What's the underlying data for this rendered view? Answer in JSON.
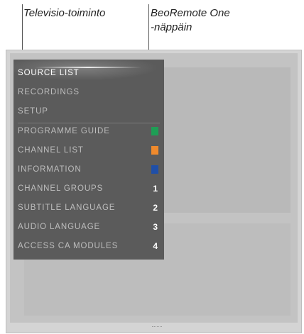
{
  "annotations": {
    "tv_function": "Televisio-toiminto",
    "remote_key_line1": "BeoRemote One",
    "remote_key_line2": "-näppäin"
  },
  "menu": {
    "selected": "SOURCE LIST",
    "items": [
      {
        "label": "SOURCE LIST",
        "key": ""
      },
      {
        "label": "RECORDINGS",
        "key": ""
      },
      {
        "label": "SETUP",
        "key": ""
      },
      {
        "label": "PROGRAMME GUIDE",
        "key": "",
        "color": "#1e9e55"
      },
      {
        "label": "CHANNEL LIST",
        "key": "",
        "color": "#f08a2c"
      },
      {
        "label": "INFORMATION",
        "key": "",
        "color": "#1f4fa8"
      },
      {
        "label": "CHANNEL GROUPS",
        "key": "1"
      },
      {
        "label": "SUBTITLE LANGUAGE",
        "key": "2"
      },
      {
        "label": "AUDIO LANGUAGE",
        "key": "3"
      },
      {
        "label": "ACCESS CA MODULES",
        "key": "4"
      }
    ]
  },
  "colors": {
    "menu_background": "#5b5b5b",
    "screen_background": "#c3c3c3",
    "green_key": "#1e9e55",
    "orange_key": "#f08a2c",
    "blue_key": "#1f4fa8"
  }
}
